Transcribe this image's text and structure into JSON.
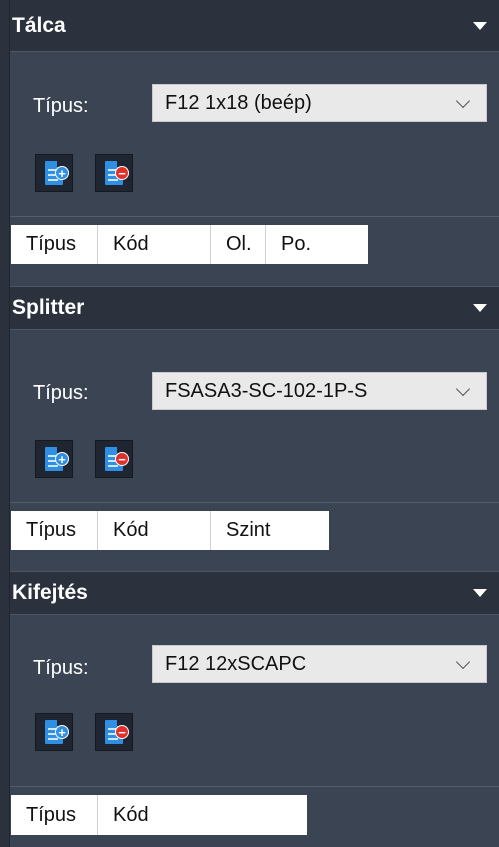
{
  "sections": [
    {
      "title": "Tálca",
      "type_label": "Típus:",
      "type_value": "F12 1x18 (beép)",
      "columns": [
        "Típus",
        "Kód",
        "Ol.",
        "Po."
      ]
    },
    {
      "title": "Splitter",
      "type_label": "Típus:",
      "type_value": "FSASA3-SC-102-1P-S",
      "columns": [
        "Típus",
        "Kód",
        "Szint"
      ]
    },
    {
      "title": "Kifejtés",
      "type_label": "Típus:",
      "type_value": "F12 12xSCAPC",
      "columns": [
        "Típus",
        "Kód"
      ]
    }
  ],
  "colors": {
    "panel_bg": "#3b4452",
    "header_bg": "#2b323d",
    "add_icon": "#2e8fe3",
    "remove_icon": "#e0302a"
  },
  "icons": {
    "add": "add-row-icon",
    "remove": "remove-row-icon",
    "collapse": "collapse-triangle-icon",
    "dropdown": "chevron-down-icon"
  }
}
